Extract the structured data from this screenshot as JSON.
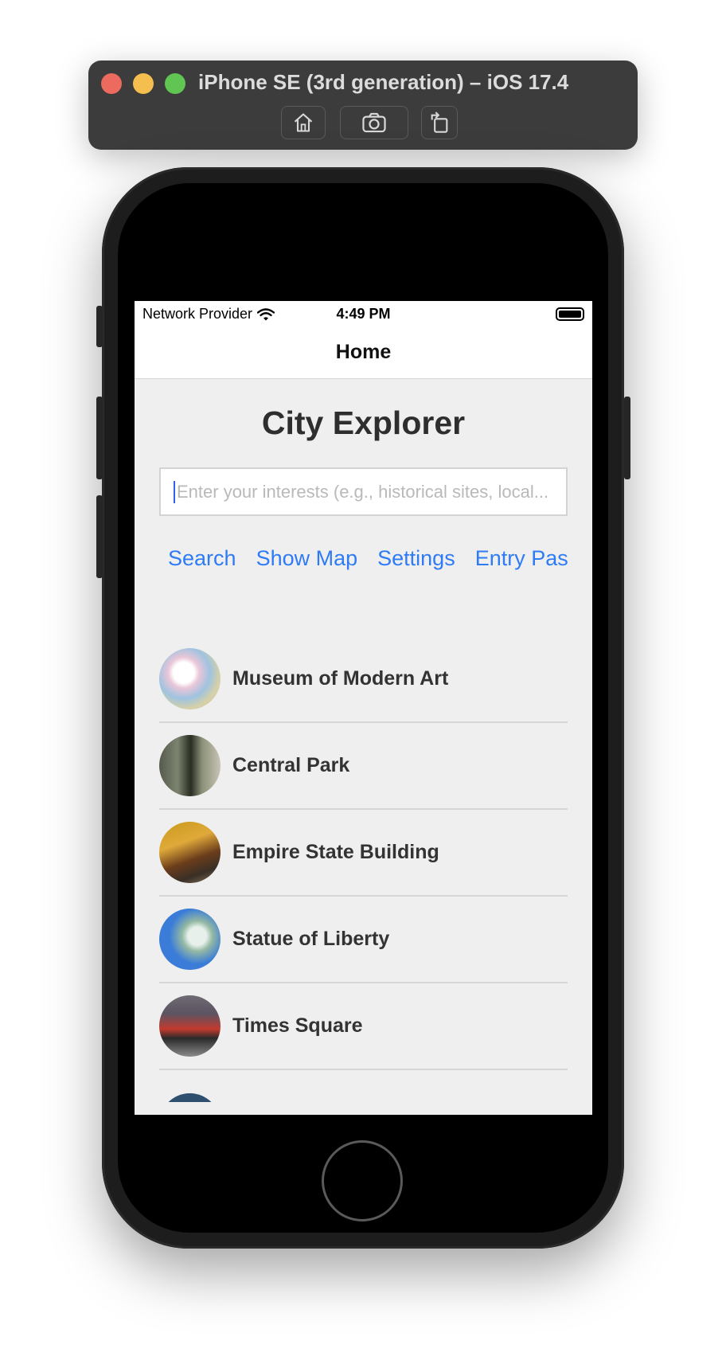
{
  "simulator": {
    "title": "iPhone SE (3rd generation) – iOS 17.4",
    "buttons": [
      "home-icon",
      "screenshot-icon",
      "rotate-icon"
    ]
  },
  "status_bar": {
    "carrier": "Network Provider",
    "time": "4:49 PM"
  },
  "nav": {
    "title": "Home"
  },
  "app": {
    "title": "City Explorer",
    "search_placeholder": "Enter your interests (e.g., historical sites, local...",
    "actions": [
      "Search",
      "Show Map",
      "Settings",
      "Entry Pass"
    ]
  },
  "places": [
    {
      "name": "Museum of Modern Art"
    },
    {
      "name": "Central Park"
    },
    {
      "name": "Empire State Building"
    },
    {
      "name": "Statue of Liberty"
    },
    {
      "name": "Times Square"
    }
  ],
  "colors": {
    "accent": "#2f7bf5",
    "screen_bg": "#efefef",
    "text": "#333333"
  }
}
